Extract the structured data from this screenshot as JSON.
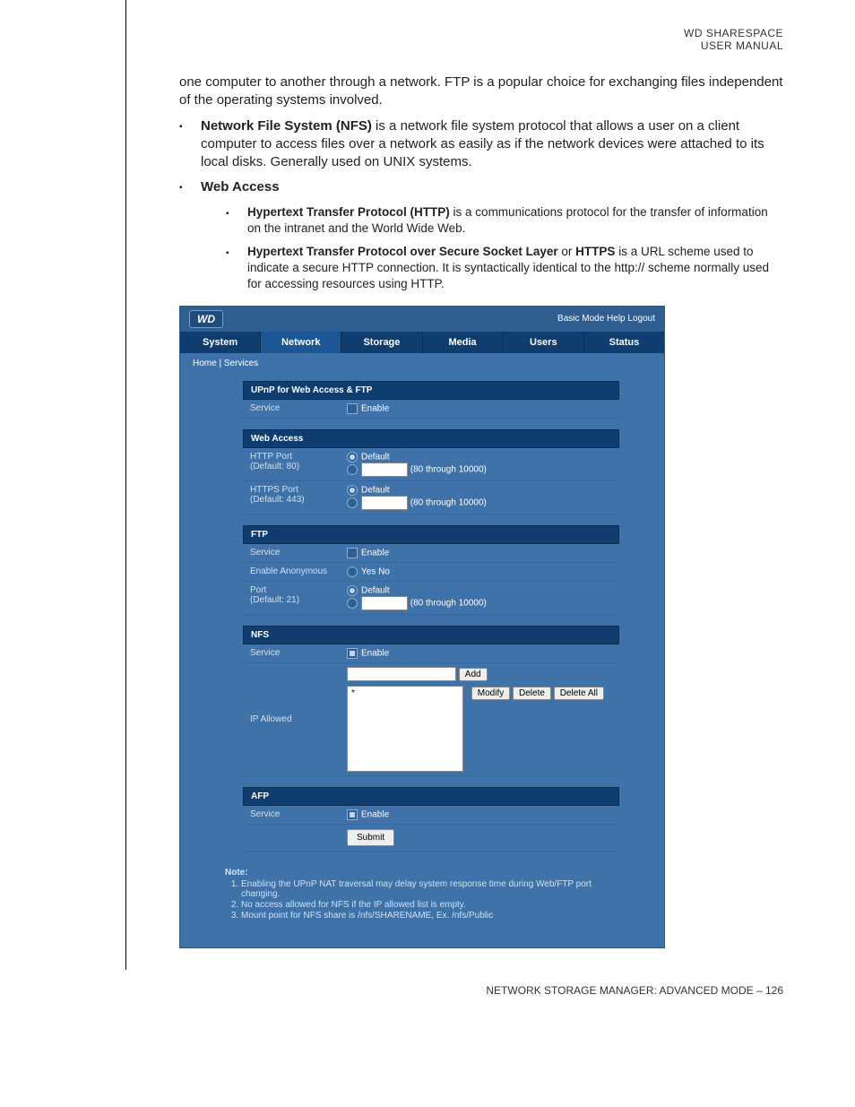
{
  "header": {
    "line1": "WD SHARESPACE",
    "line2": "USER MANUAL"
  },
  "body": {
    "ftp_cont": "one computer to another through a network. FTP is a popular choice for exchanging files independent of the operating systems involved.",
    "nfs_title": "Network File System (NFS)",
    "nfs_text": " is a network file system protocol that allows a user on a client computer to access files over a network as easily as if the network devices were attached to its local disks. Generally used on UNIX systems.",
    "web_title": "Web Access",
    "http_title": "Hypertext Transfer Protocol (HTTP)",
    "http_text": " is a communications protocol for the transfer of information on the intranet and the World Wide Web.",
    "https_title": "Hypertext Transfer Protocol over Secure Socket Layer",
    "https_or": " or ",
    "https_bold": "HTTPS",
    "https_text": " is a URL scheme used to indicate a secure HTTP connection. It is syntactically identical to the http:// scheme normally used for accessing resources using HTTP."
  },
  "ui": {
    "topright": "Basic Mode Help Logout",
    "logo": "WD",
    "tabs": [
      "System",
      "Network",
      "Storage",
      "Media",
      "Users",
      "Status"
    ],
    "breadcrumb": "Home | Services",
    "sect_upnp": "UPnP for Web Access & FTP",
    "lbl_service": "Service",
    "lbl_enable": "Enable",
    "sect_web": "Web Access",
    "lbl_http": "HTTP Port",
    "lbl_http2": "(Default: 80)",
    "lbl_https": "HTTPS Port",
    "lbl_https2": "(Default: 443)",
    "lbl_default": "Default",
    "lbl_range": "(80 through 10000)",
    "sect_ftp": "FTP",
    "lbl_anon": "Enable Anonymous",
    "lbl_yes": "Yes",
    "lbl_no": "No",
    "lbl_port": "Port",
    "lbl_port2": "(Default: 21)",
    "sect_nfs": "NFS",
    "lbl_ip": "IP Allowed",
    "list_item": "*",
    "btn_add": "Add",
    "btn_mod": "Modify",
    "btn_del": "Delete",
    "btn_delall": "Delete All",
    "sect_afp": "AFP",
    "btn_submit": "Submit",
    "notes_title": "Note:",
    "note1": "Enabling the UPnP NAT traversal may delay system response time during Web/FTP port changing.",
    "note2": "No access allowed for NFS if the IP allowed list is empty.",
    "note3": "Mount point for NFS share is /nfs/SHARENAME, Ex. /nfs/Public"
  },
  "footer": "NETWORK STORAGE MANAGER: ADVANCED MODE – 126"
}
